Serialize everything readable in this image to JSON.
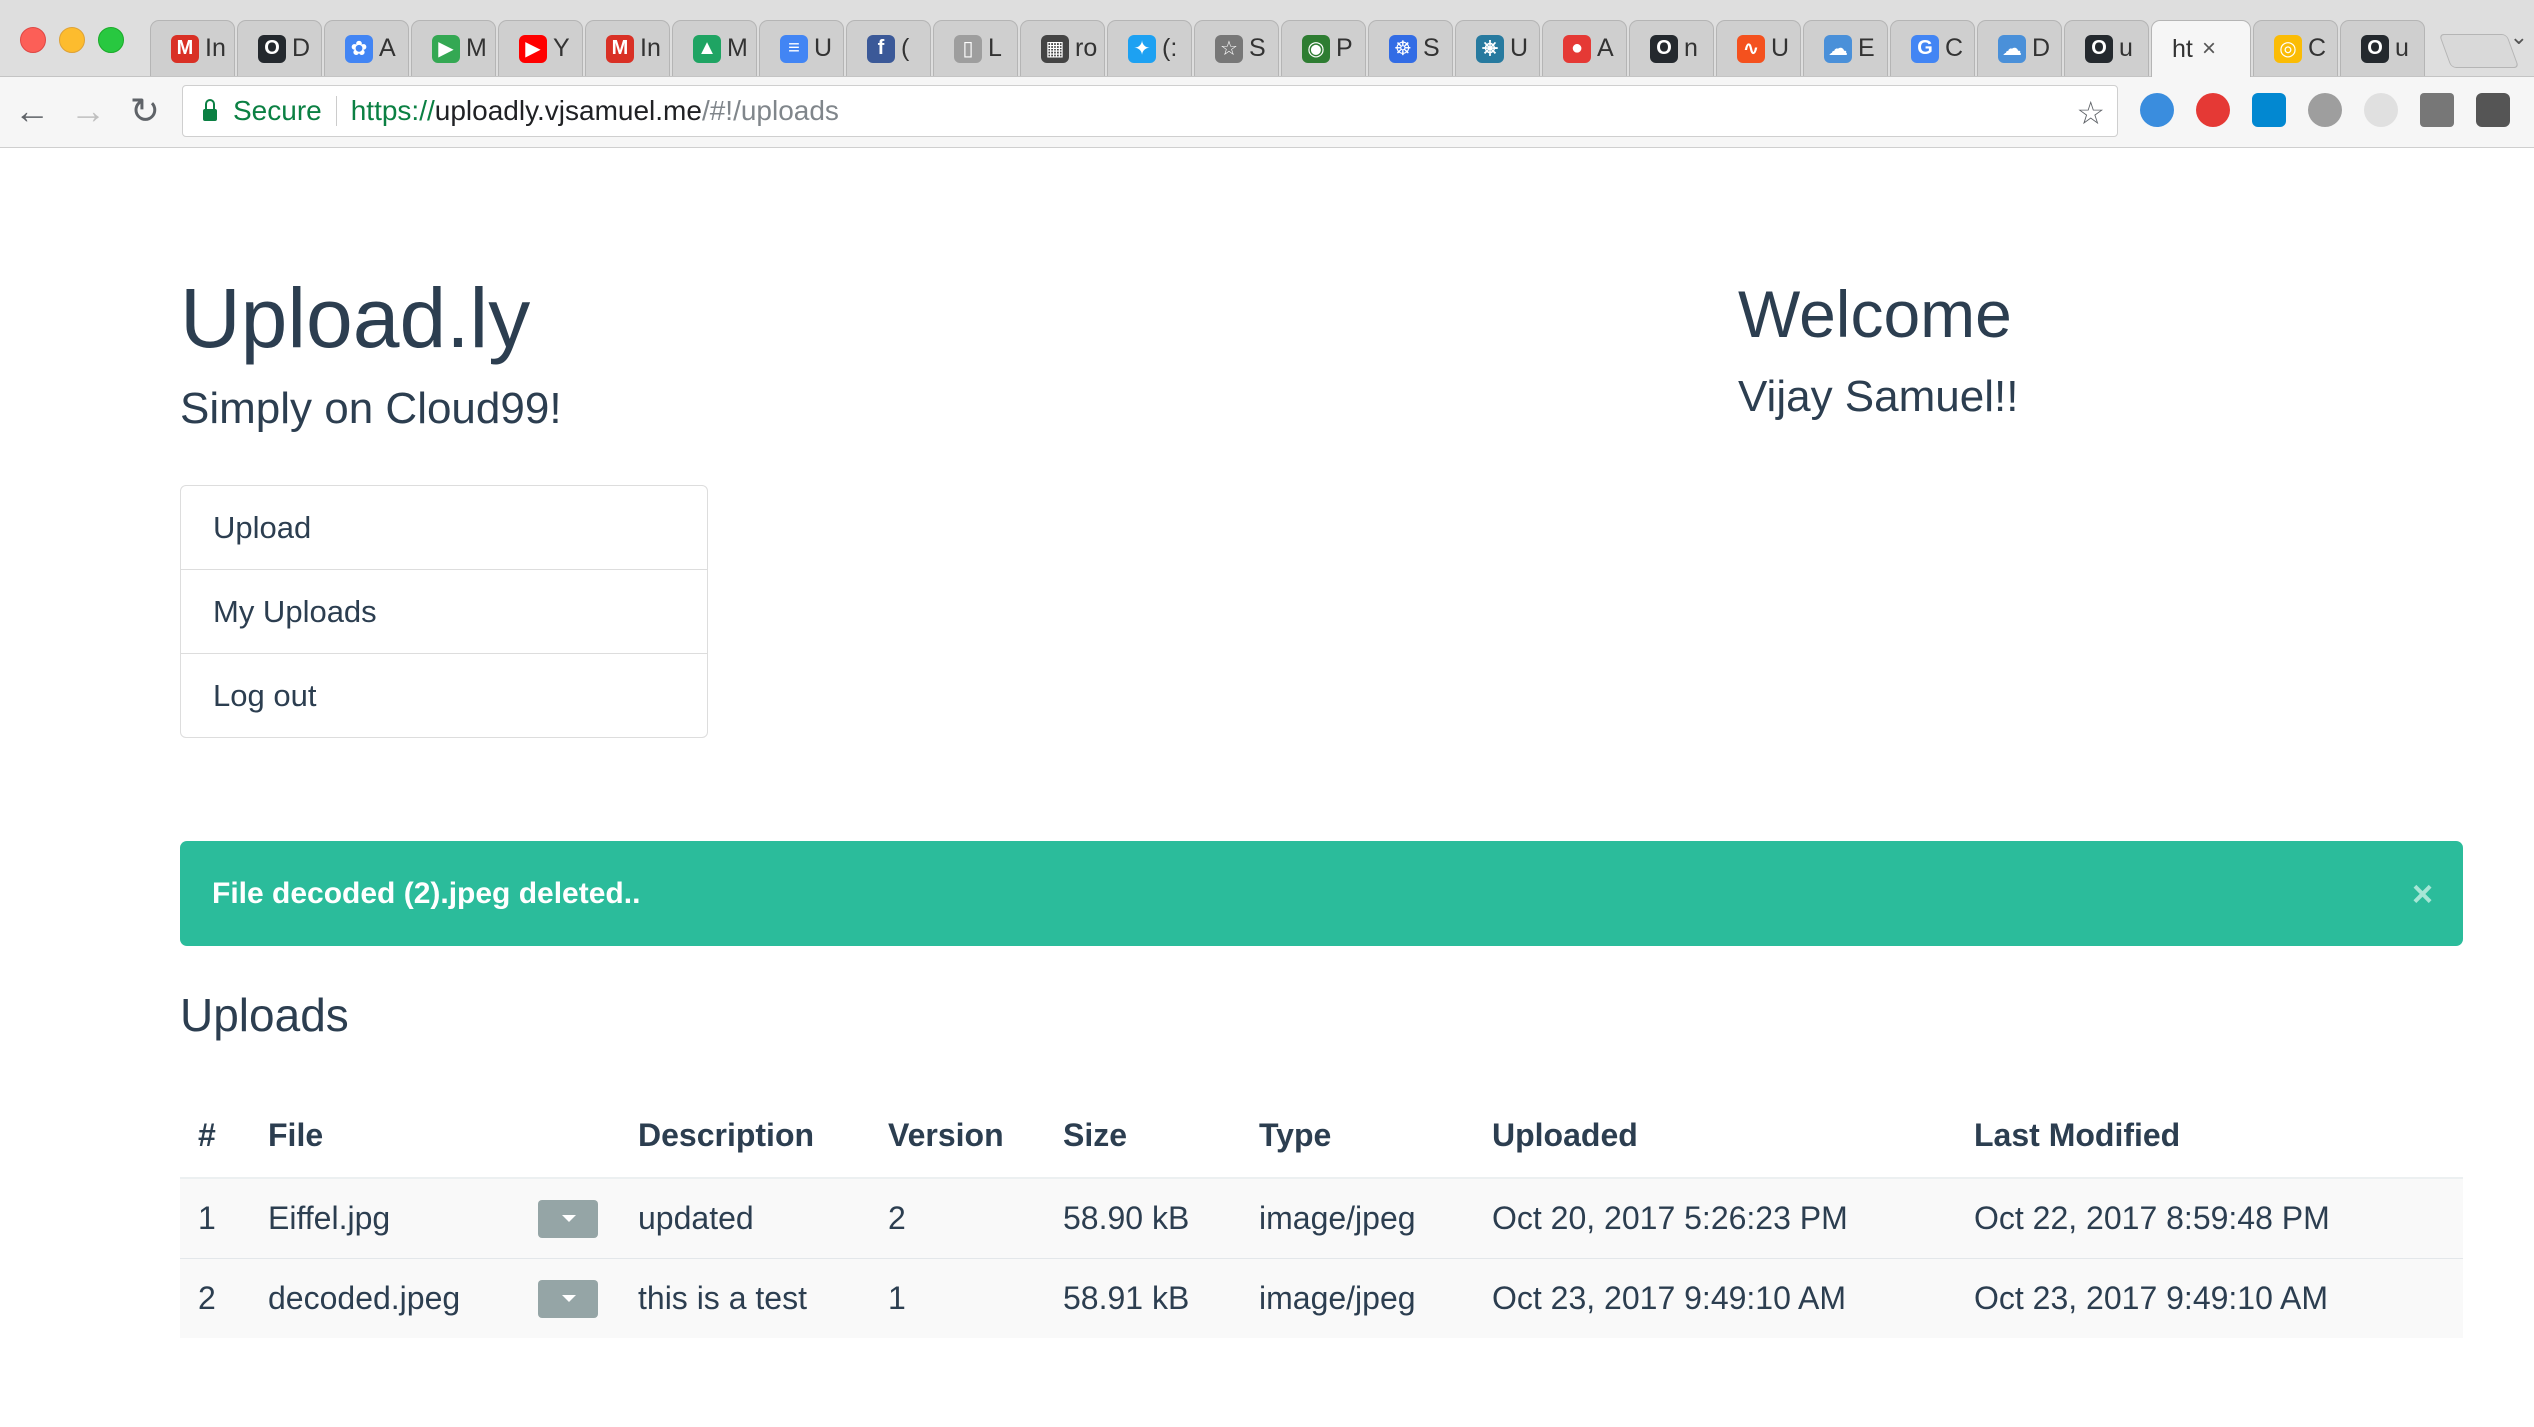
{
  "browser": {
    "tabs": [
      {
        "letter": "M",
        "label": "In",
        "color": "#d93025"
      },
      {
        "letter": "O",
        "label": "D",
        "color": "#24292e"
      },
      {
        "letter": "✿",
        "label": "A",
        "color": "#4285f4"
      },
      {
        "letter": "▶",
        "label": "M",
        "color": "#34a853"
      },
      {
        "letter": "▶",
        "label": "Y",
        "color": "#ff0000"
      },
      {
        "letter": "M",
        "label": "In",
        "color": "#d93025"
      },
      {
        "letter": "▲",
        "label": "M",
        "color": "#1fa463"
      },
      {
        "letter": "≡",
        "label": "U",
        "color": "#4285f4"
      },
      {
        "letter": "f",
        "label": "(",
        "color": "#3b5998"
      },
      {
        "letter": "▯",
        "label": "L",
        "color": "#9e9e9e"
      },
      {
        "letter": "▦",
        "label": "ro",
        "color": "#444444"
      },
      {
        "letter": "✦",
        "label": "(:",
        "color": "#1da1f2"
      },
      {
        "letter": "☆",
        "label": "S",
        "color": "#777777"
      },
      {
        "letter": "◉",
        "label": "P",
        "color": "#2e7d32"
      },
      {
        "letter": "☸",
        "label": "S",
        "color": "#326ce5"
      },
      {
        "letter": "⎈",
        "label": "U",
        "color": "#277a9f"
      },
      {
        "letter": "●",
        "label": "A",
        "color": "#e53935"
      },
      {
        "letter": "O",
        "label": "n",
        "color": "#24292e"
      },
      {
        "letter": "∿",
        "label": "U",
        "color": "#f4511e"
      },
      {
        "letter": "☁",
        "label": "E",
        "color": "#4a90d9"
      },
      {
        "letter": "G",
        "label": "C",
        "color": "#4285f4"
      },
      {
        "letter": "☁",
        "label": "D",
        "color": "#4a90d9"
      },
      {
        "letter": "O",
        "label": "u",
        "color": "#24292e"
      },
      {
        "letter": "",
        "label": "ht",
        "color": "#ffffff",
        "active": true
      },
      {
        "letter": "◎",
        "label": "C",
        "color": "#fbbc05"
      },
      {
        "letter": "O",
        "label": "u",
        "color": "#24292e"
      }
    ],
    "url": {
      "secure_label": "Secure",
      "scheme": "https://",
      "host": "uploadly.vjsamuel.me",
      "path": "/#!/uploads"
    }
  },
  "app": {
    "title": "Upload.ly",
    "subtitle": "Simply on Cloud99!"
  },
  "welcome": {
    "title": "Welcome",
    "name": "Vijay Samuel!!"
  },
  "menu": [
    "Upload",
    "My Uploads",
    "Log out"
  ],
  "alert": {
    "message": "File decoded (2).jpeg deleted..",
    "close": "×",
    "color": "#2bbc9b"
  },
  "uploads": {
    "title": "Uploads",
    "columns": [
      "#",
      "File",
      "",
      "Description",
      "Version",
      "Size",
      "Type",
      "Uploaded",
      "Last Modified"
    ],
    "rows": [
      {
        "num": "1",
        "file": "Eiffel.jpg",
        "description": "updated",
        "version": "2",
        "size": "58.90 kB",
        "type": "image/jpeg",
        "uploaded": "Oct 20, 2017 5:26:23 PM",
        "modified": "Oct 22, 2017 8:59:48 PM"
      },
      {
        "num": "2",
        "file": "decoded.jpeg",
        "description": "this is a test",
        "version": "1",
        "size": "58.91 kB",
        "type": "image/jpeg",
        "uploaded": "Oct 23, 2017 9:49:10 AM",
        "modified": "Oct 23, 2017 9:49:10 AM"
      }
    ]
  }
}
